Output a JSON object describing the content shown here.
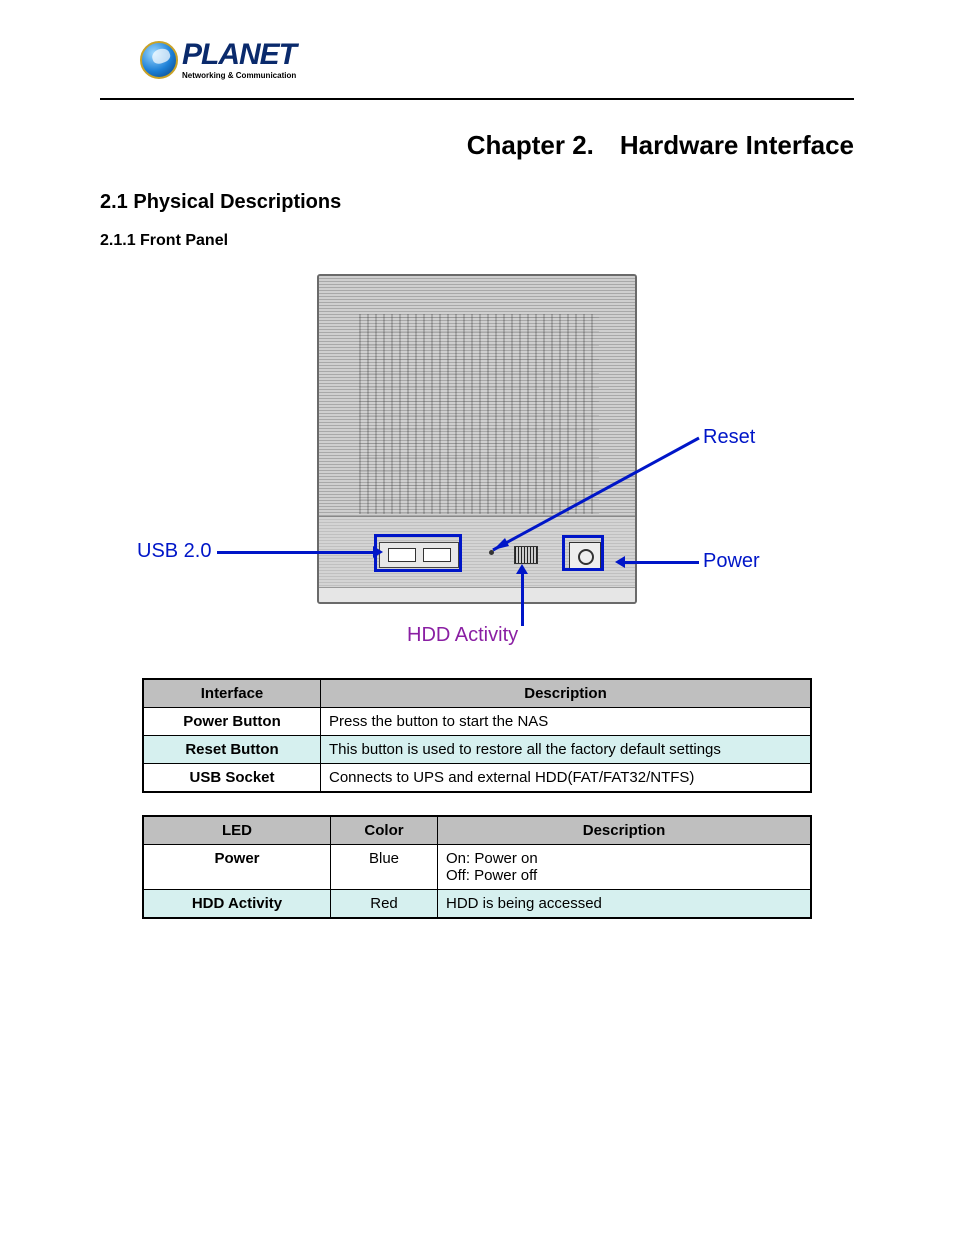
{
  "brand": {
    "name": "PLANET",
    "tagline": "Networking & Communication"
  },
  "headings": {
    "chapter": "Chapter 2. Hardware Interface",
    "section": "2.1 Physical Descriptions",
    "subsection": "2.1.1 Front Panel"
  },
  "diagram_labels": {
    "usb": "USB 2.0",
    "reset": "Reset",
    "power": "Power",
    "hdd_activity": "HDD Activity"
  },
  "interface_table": {
    "headers": {
      "col1": "Interface",
      "col2": "Description"
    },
    "rows": [
      {
        "name": "Power Button",
        "desc": "Press the button to start the NAS",
        "alt": false
      },
      {
        "name": "Reset Button",
        "desc": "This button is used to restore all the factory default settings",
        "alt": true
      },
      {
        "name": "USB Socket",
        "desc": "Connects to UPS and external HDD(FAT/FAT32/NTFS)",
        "alt": false
      }
    ]
  },
  "led_table": {
    "headers": {
      "col1": "LED",
      "col2": "Color",
      "col3": "Description"
    },
    "rows": [
      {
        "name": "Power",
        "color": "Blue",
        "desc": "On: Power on\nOff: Power off",
        "alt": false
      },
      {
        "name": "HDD Activity",
        "color": "Red",
        "desc": "HDD is being accessed",
        "alt": true
      }
    ]
  }
}
